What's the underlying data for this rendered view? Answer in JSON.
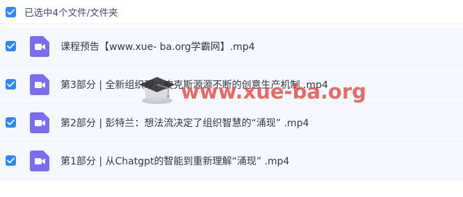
{
  "header": {
    "label": "已选中4个文件/文件夹"
  },
  "files": [
    {
      "name": "课程预告【www.xue- ba.org学霸网】.mp4"
    },
    {
      "name": "第3部分 | 全新组织观：皮克斯源源不断的创意生产机制 .mp4"
    },
    {
      "name": "第2部分 | 彭特兰：想法流决定了组织智慧的“涌现” .mp4"
    },
    {
      "name": "第1部分 | 从Chatgpt的智能到重新理解“涌现” .mp4"
    }
  ],
  "watermark": {
    "text": "www.xue-ba.org"
  },
  "colors": {
    "checkbox": "#2f87ff",
    "video_icon": "#7b6cf6",
    "row_background": "#f5f9ff",
    "watermark": "#e23a34"
  },
  "icons": {
    "checkbox": "check-icon",
    "file": "video-file-icon",
    "watermark": "mortarboard-icon"
  }
}
